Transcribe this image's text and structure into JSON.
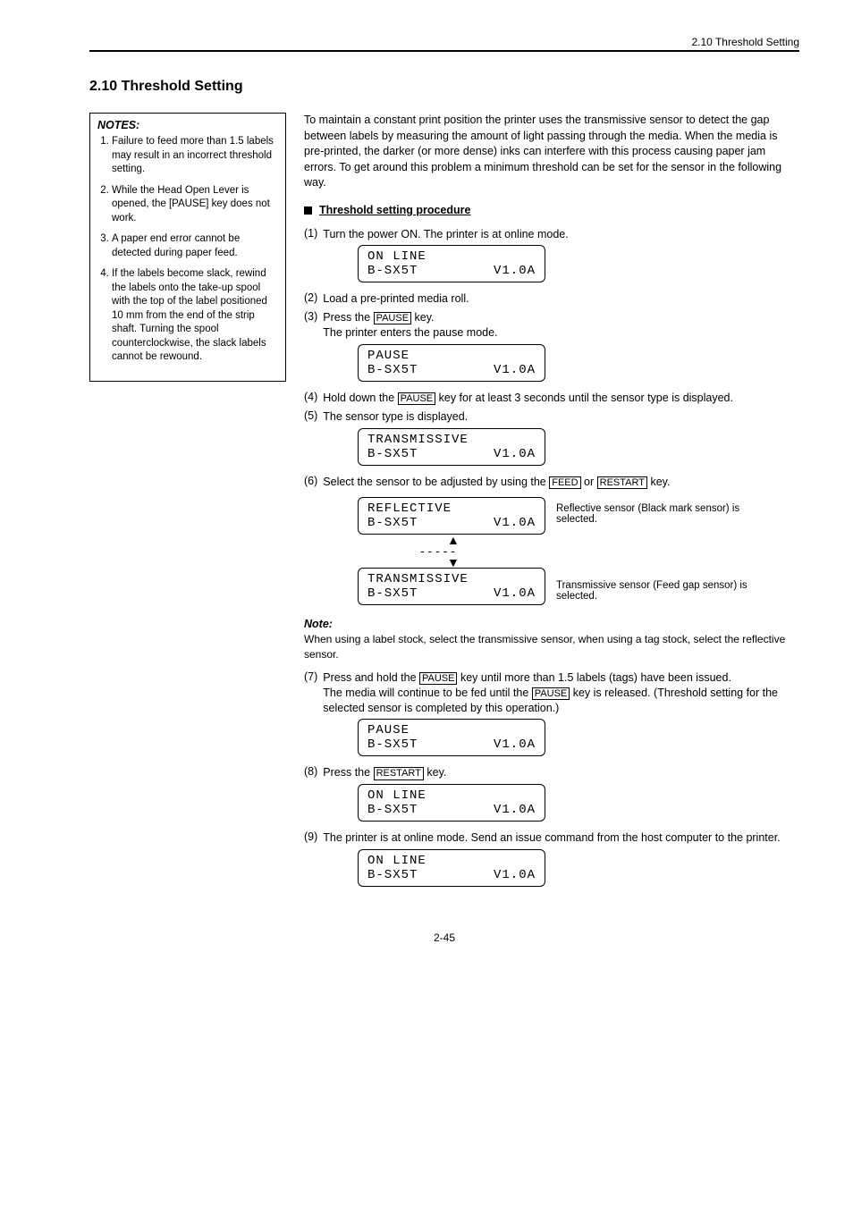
{
  "header": {
    "section": "2.10 Threshold Setting"
  },
  "title": "2.10 Threshold Setting",
  "notebox": {
    "title": "NOTES:",
    "items": [
      "Failure to feed more than 1.5 labels may result in an incorrect threshold setting.",
      "While the Head Open Lever is opened, the [PAUSE] key does not work.",
      "A paper end error cannot be detected during paper feed.",
      "If the labels become slack, rewind the labels onto the take-up spool with the top of the label positioned 10 mm from the end of the strip shaft. Turning the spool counterclockwise, the slack labels cannot be rewound."
    ]
  },
  "intro": "To maintain a constant print position the printer uses the transmissive sensor to detect the gap between labels by measuring the amount of light passing through the media. When the media is pre-printed, the darker (or more dense) inks can interfere with this process causing paper jam errors. To get around this problem a minimum threshold can be set for the sensor in the following way.",
  "bullet": "Threshold setting procedure",
  "steps": {
    "s1": "Turn the power ON. The printer is at online mode.",
    "s2": "Load a pre-printed media roll.",
    "s3_pre": "Press the ",
    "s3_key": "PAUSE",
    "s3_post": " key.",
    "s4_a": "The printer enters the pause mode.",
    "s4_pre": "Hold down the ",
    "s4_key": "PAUSE",
    "s4_mid": " key for at least 3 seconds until the sensor type is displayed.",
    "s5": "The sensor type is displayed.",
    "s6_pre": "Select the sensor to be adjusted by using the ",
    "s6_key1": "FEED",
    "s6_or": " or ",
    "s6_key2": "RESTART",
    "s6_post": " key.",
    "s7_pre": "Press and hold the ",
    "s7_key": "PAUSE",
    "s7_post": " key until more than 1.5 labels (tags) have been issued.",
    "s7_b_pre": "The media will continue to be fed until the ",
    "s7_b_key": "PAUSE",
    "s7_b_post": " key is released. (Threshold setting for the selected sensor is completed by this operation.)",
    "s8_pre": "Press the ",
    "s8_key": "RESTART",
    "s8_post": " key.",
    "s9": "The printer is at online mode. Send an issue command from the host computer to the printer."
  },
  "afterStep6Note": "Note:",
  "afterStep6": "When using a label stock, select the transmissive sensor, when using a tag stock, select the reflective sensor.",
  "lcd": {
    "online": {
      "l1": "ON LINE",
      "l2l": "B-SX5T",
      "l2r": "V1.0A"
    },
    "pause": {
      "l1": "PAUSE",
      "l2l": "B-SX5T",
      "l2r": "V1.0A"
    },
    "trans": {
      "l1": "TRANSMISSIVE",
      "l2l": "B-SX5T",
      "l2r": "V1.0A"
    },
    "reflect": {
      "l1": "REFLECTIVE",
      "l2l": "B-SX5T",
      "l2r": "V1.0A"
    }
  },
  "reflectCaption": "Reflective sensor (Black mark sensor) is selected.",
  "transCaption": "Transmissive sensor (Feed gap sensor) is selected.",
  "pageNumber": "2-45"
}
